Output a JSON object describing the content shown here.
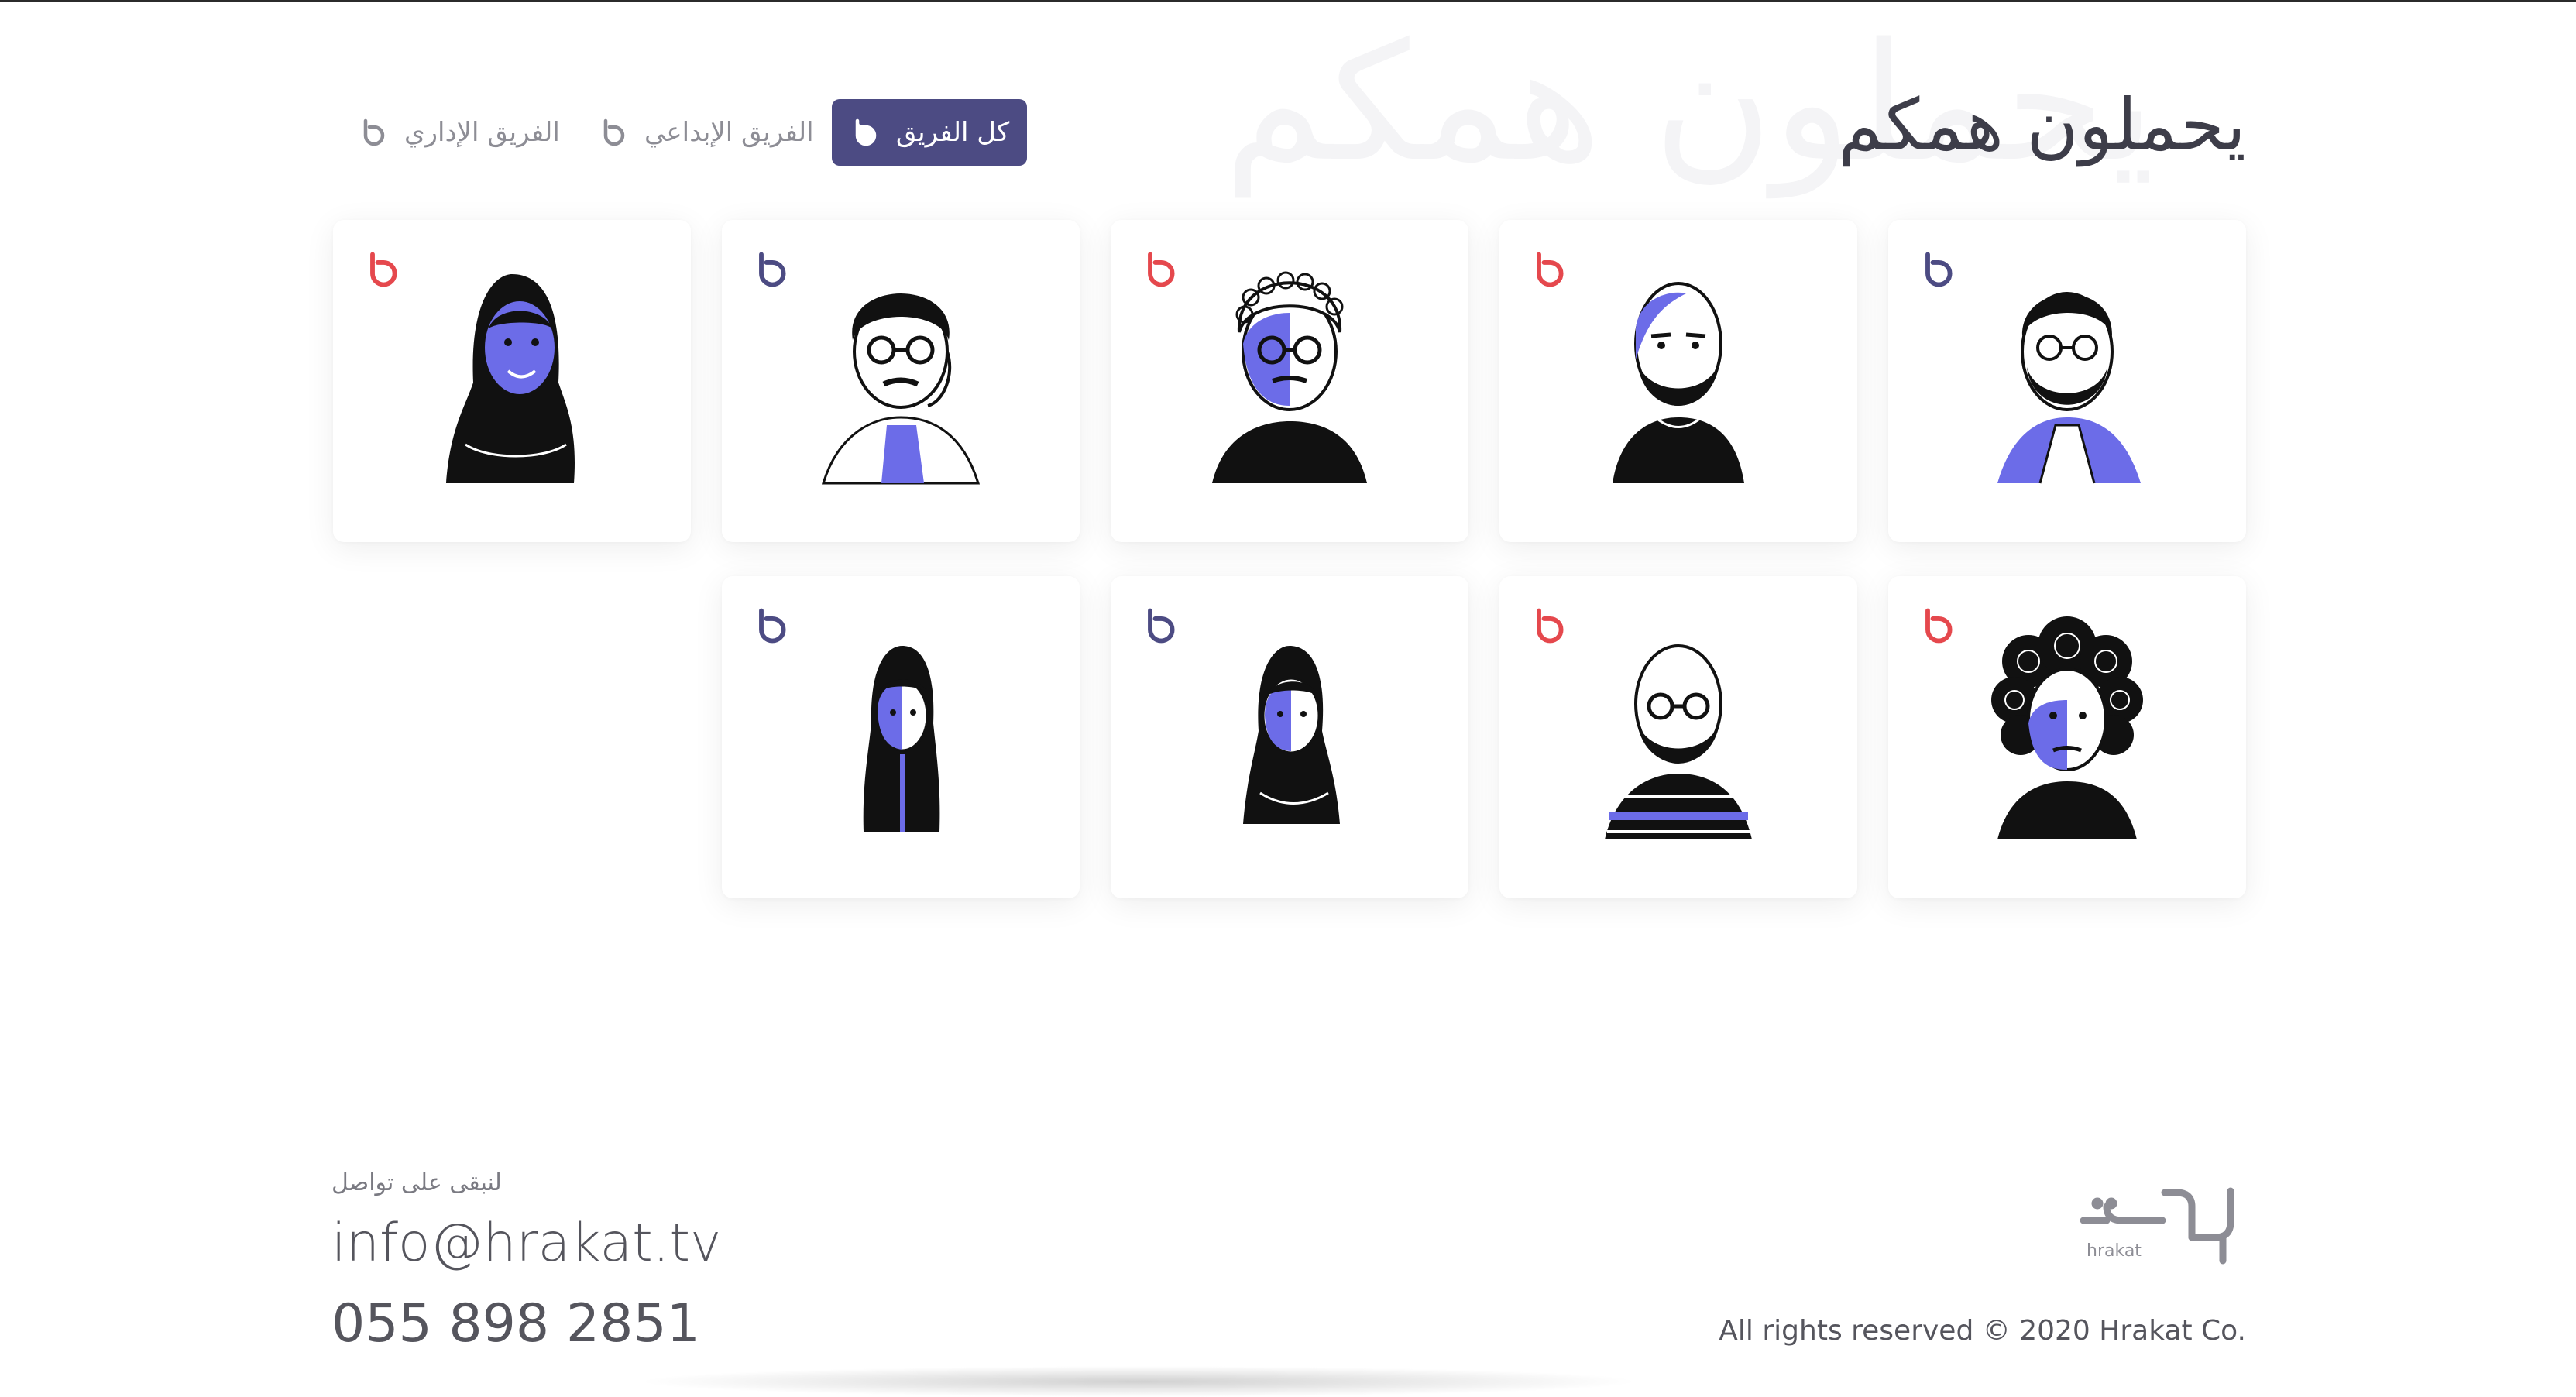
{
  "header": {
    "title": "يحملون همكم",
    "ghost_title": "يحملون همكم"
  },
  "filters": [
    {
      "label": "كل الفريق",
      "active": true
    },
    {
      "label": "الفريق الإبداعي",
      "active": false
    },
    {
      "label": "الفريق الإداري",
      "active": false
    }
  ],
  "team_cards": [
    {
      "portrait": "man-glasses-beard-thobe-icon",
      "badge_color": "#4c4b83"
    },
    {
      "portrait": "bald-man-beard-tshirt-icon",
      "badge_color": "#e5484d"
    },
    {
      "portrait": "man-curly-hair-glasses-icon",
      "badge_color": "#e5484d"
    },
    {
      "portrait": "man-glasses-mustache-thobe-icon",
      "badge_color": "#4c4b83"
    },
    {
      "portrait": "woman-hijab-smiling-icon",
      "badge_color": "#e5484d"
    },
    {
      "portrait": "man-curly-afro-hair-icon",
      "badge_color": "#e5484d"
    },
    {
      "portrait": "bald-man-glasses-striped-shirt-icon",
      "badge_color": "#e5484d"
    },
    {
      "portrait": "woman-hijab-icon",
      "badge_color": "#4c4b83"
    },
    {
      "portrait": "woman-long-hair-veil-icon",
      "badge_color": "#4c4b83"
    }
  ],
  "footer": {
    "contact_label": "لنبقى على تواصل",
    "email": "info@hrakat.tv",
    "phone": "055 898 2851",
    "copyright": "All rights reserved © 2020 Hrakat Co.",
    "logo_sub": "hrakat"
  },
  "colors": {
    "accent": "#4c4b83",
    "highlight": "#6c6ce8",
    "red": "#e5484d"
  }
}
